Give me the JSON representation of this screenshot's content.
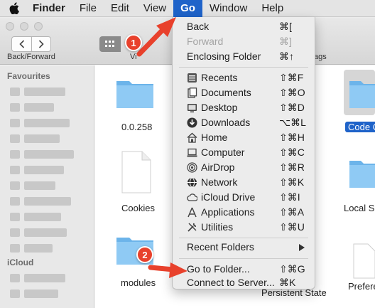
{
  "menubar": {
    "items": [
      {
        "label": "Finder"
      },
      {
        "label": "File"
      },
      {
        "label": "Edit"
      },
      {
        "label": "View"
      },
      {
        "label": "Go"
      },
      {
        "label": "Window"
      },
      {
        "label": "Help"
      }
    ],
    "active_color": "#1f63c9"
  },
  "toolbar": {
    "back_forward_label": "Back/Forward",
    "view_label_partial": "Vi",
    "tags_label_partial": "ags"
  },
  "sidebar": {
    "favourites_heading": "Favourites",
    "icloud_heading": "iCloud"
  },
  "files": [
    {
      "name": "0.0.258",
      "kind": "folder"
    },
    {
      "name": "Code C",
      "kind": "folder",
      "selected": true
    },
    {
      "name": "Cookies",
      "kind": "document"
    },
    {
      "name": "Local S",
      "kind": "folder"
    },
    {
      "name": "modules",
      "kind": "folder"
    },
    {
      "name": "Persistent State",
      "kind": "document"
    },
    {
      "name": "Prefere",
      "kind": "document"
    }
  ],
  "go_menu": {
    "items": [
      {
        "label": "Back",
        "shortcut": "⌘[",
        "enabled": true
      },
      {
        "label": "Forward",
        "shortcut": "⌘]",
        "enabled": false
      },
      {
        "label": "Enclosing Folder",
        "shortcut": "⌘↑",
        "enabled": true
      },
      {
        "label": "Recents",
        "shortcut": "⇧⌘F",
        "icon": "clock-list-icon"
      },
      {
        "label": "Documents",
        "shortcut": "⇧⌘O",
        "icon": "documents-icon"
      },
      {
        "label": "Desktop",
        "shortcut": "⇧⌘D",
        "icon": "desktop-icon"
      },
      {
        "label": "Downloads",
        "shortcut": "⌥⌘L",
        "icon": "download-icon"
      },
      {
        "label": "Home",
        "shortcut": "⇧⌘H",
        "icon": "home-icon"
      },
      {
        "label": "Computer",
        "shortcut": "⇧⌘C",
        "icon": "computer-icon"
      },
      {
        "label": "AirDrop",
        "shortcut": "⇧⌘R",
        "icon": "airdrop-icon"
      },
      {
        "label": "Network",
        "shortcut": "⇧⌘K",
        "icon": "network-icon"
      },
      {
        "label": "iCloud Drive",
        "shortcut": "⇧⌘I",
        "icon": "cloud-icon"
      },
      {
        "label": "Applications",
        "shortcut": "⇧⌘A",
        "icon": "applications-icon"
      },
      {
        "label": "Utilities",
        "shortcut": "⇧⌘U",
        "icon": "utilities-icon"
      },
      {
        "label": "Recent Folders"
      },
      {
        "label": "Go to Folder...",
        "shortcut": "⇧⌘G"
      },
      {
        "label": "Connect to Server...",
        "shortcut": "⌘K"
      }
    ]
  },
  "annotations": {
    "step1": "1",
    "step2": "2",
    "color": "#e8412c"
  }
}
